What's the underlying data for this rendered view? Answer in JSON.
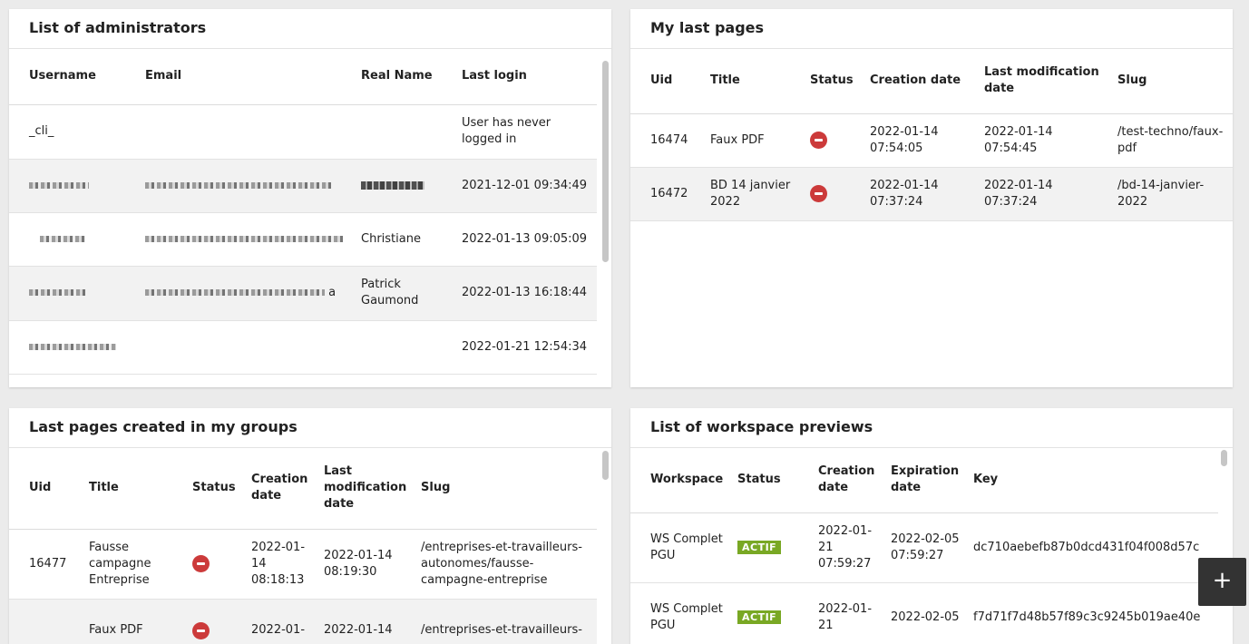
{
  "admins": {
    "title": "List of administrators",
    "columns": [
      "Username",
      "Email",
      "Real Name",
      "Last login"
    ],
    "rows": [
      {
        "username": "_cli_",
        "email": "",
        "real_name": "",
        "last_login": "User has never logged in"
      },
      {
        "username": "",
        "email": "",
        "real_name": "",
        "last_login": "2021-12-01 09:34:49"
      },
      {
        "username": "",
        "email": "",
        "real_name": "Christiane",
        "last_login": "2022-01-13 09:05:09"
      },
      {
        "username": "",
        "email": "a",
        "real_name": "Patrick Gaumond",
        "last_login": "2022-01-13 16:18:44"
      },
      {
        "username": "",
        "email": "",
        "real_name": "",
        "last_login": "2022-01-21 12:54:34"
      }
    ]
  },
  "my_pages": {
    "title": "My last pages",
    "columns": [
      "Uid",
      "Title",
      "Status",
      "Creation date",
      "Last modification date",
      "Slug"
    ],
    "rows": [
      {
        "uid": "16474",
        "title": "Faux PDF",
        "status_icon": "minus-circle-icon",
        "created": "2022-01-14 07:54:05",
        "modified": "2022-01-14 07:54:45",
        "slug": "/test-techno/faux-pdf"
      },
      {
        "uid": "16472",
        "title": "BD 14 janvier 2022",
        "status_icon": "minus-circle-icon",
        "created": "2022-01-14 07:37:24",
        "modified": "2022-01-14 07:37:24",
        "slug": "/bd-14-janvier-2022"
      }
    ]
  },
  "group_pages": {
    "title": "Last pages created in my groups",
    "columns": [
      "Uid",
      "Title",
      "Status",
      "Creation date",
      "Last modification date",
      "Slug"
    ],
    "rows": [
      {
        "uid": "16477",
        "title": "Fausse campagne Entreprise",
        "status_icon": "minus-circle-icon",
        "created": "2022-01-14 08:18:13",
        "modified": "2022-01-14 08:19:30",
        "slug": "/entreprises-et-travailleurs-autonomes/fausse-campagne-entreprise"
      },
      {
        "uid": "",
        "title": "Faux PDF",
        "status_icon": "minus-circle-icon",
        "created": "2022-01-",
        "modified": "2022-01-14",
        "slug": "/entreprises-et-travailleurs-"
      }
    ]
  },
  "previews": {
    "title": "List of workspace previews",
    "columns": [
      "Workspace",
      "Status",
      "Creation date",
      "Expiration date",
      "Key"
    ],
    "rows": [
      {
        "workspace": "WS Complet PGU",
        "status": "ACTIF",
        "created": "2022-01-21 07:59:27",
        "expires": "2022-02-05 07:59:27",
        "key": "dc710aebefb87b0dcd431f04f008d57c"
      },
      {
        "workspace": "WS Complet PGU",
        "status": "ACTIF",
        "created": "2022-01-21",
        "expires": "2022-02-05",
        "key": "f7d71f7d48b57f89c3c9245b019ae40e"
      }
    ]
  },
  "fab": {
    "label": "+"
  },
  "colors": {
    "status_red": "#cc3a3a",
    "badge_green": "#79a824",
    "row_alt": "#f2f2f2"
  }
}
